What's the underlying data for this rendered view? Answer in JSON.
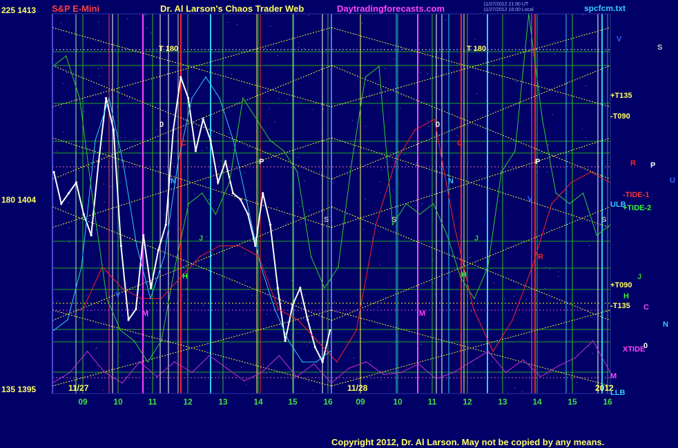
{
  "header": {
    "left_title": "S&P E-Mini",
    "center_title": "Dr. Al Larson's Chaos Trader Web",
    "site": "Daytradingforecasts.com",
    "file": "spcfcm.txt",
    "timestamp_1": "11/27/2012 21:00 UT",
    "timestamp_2": "11/27/2012 16:00 Local"
  },
  "y_axis": {
    "labels": [
      {
        "angle": "225",
        "price": "1413"
      },
      {
        "angle": "180",
        "price": "1404"
      },
      {
        "angle": "135",
        "price": "1395"
      }
    ]
  },
  "x_axis": {
    "day1_label": "11/27",
    "day2_label": "11/28",
    "year_label": "2012",
    "hours_day1": [
      "09",
      "10",
      "11",
      "12",
      "13",
      "14",
      "15",
      "16"
    ],
    "hours_day2": [
      "09",
      "10",
      "11",
      "12",
      "13",
      "14",
      "15",
      "16"
    ]
  },
  "line_labels": {
    "plus_t135": "+T135",
    "minus_t090": "-T090",
    "minus_tide_1": "-TIDE-1",
    "plus_tide_2": "+TIDE-2",
    "ulb": "ULB",
    "plus_t090": "+T090",
    "minus_t135": "-T135",
    "xtide": "XTIDE",
    "llb": "LLB"
  },
  "legend_letters": {
    "v": "V",
    "s": "S",
    "r": "R",
    "p": "P",
    "u": "U",
    "j": "J",
    "h": "H",
    "c": "C",
    "n": "N",
    "o": "0",
    "m": "M"
  },
  "chart_markers": {
    "t180_day1": "T 180",
    "t180_day2": "T 180",
    "o": "0",
    "p": "P",
    "s": "S",
    "h": "H",
    "v": "V",
    "m": "M",
    "n": "N",
    "c": "C",
    "j": "J",
    "r": "R"
  },
  "copyright": "Copyright 2012, Dr. Al Larson. May not be copied by any means.",
  "colors": {
    "background": "#000066",
    "grid_h": "#22aa22",
    "yellow": "#ffff00",
    "green": "#33cc33",
    "cyan": "#33ccff",
    "red": "#ff2222",
    "magenta": "#cc33cc",
    "white": "#ffffff",
    "violet": "#8888ff"
  },
  "chart_data": {
    "type": "line",
    "title": "S&P E-Mini",
    "ylim": [
      1395,
      1413
    ],
    "yticks": [
      1413,
      1404,
      1395
    ],
    "x_categories": [
      "11/27 09",
      "10",
      "11",
      "12",
      "13",
      "14",
      "15",
      "16",
      "11/28 09",
      "10",
      "11",
      "12",
      "13",
      "14",
      "15",
      "16"
    ],
    "series": [
      {
        "name": "price",
        "color": "#ffffff",
        "values": [
          1405.5,
          1404,
          1404.5,
          1405,
          1403.5,
          1402.5,
          1406,
          1409,
          1407.5,
          1402,
          1398.5,
          1399,
          1402.5,
          1400,
          1401.8,
          1403,
          1407.5,
          1410,
          1409,
          1406.5,
          1408,
          1407,
          1405,
          1406,
          1404.5,
          1404.2,
          1403.5,
          1402,
          1404.5,
          1403,
          1400,
          1397.5,
          1399.2,
          1400,
          1398.5,
          1397.2,
          1396.5,
          1398
        ]
      },
      {
        "name": "fcm",
        "color": "#33ccff",
        "values": [
          1398,
          1398.5,
          1401,
          1407,
          1409,
          1406,
          1402,
          1399.5,
          1401.5,
          1406,
          1409,
          1410,
          1409,
          1407,
          1404,
          1401,
          1399,
          1397.5,
          1396.5,
          1396.5,
          1397
        ]
      },
      {
        "name": "forecast",
        "color": "#33cc33",
        "values": [
          1410.5,
          1411,
          1409,
          1404,
          1399.5,
          1398,
          1397.5,
          1396.5,
          1397.5,
          1401,
          1404,
          1404.5,
          1403.5,
          1405,
          1409,
          1408,
          1407,
          1406.5,
          1405.5,
          1401.5,
          1400,
          1401,
          1406,
          1410,
          1410.5,
          1403,
          1404,
          1403.5,
          1404,
          1402.5,
          1400.5,
          1399.5,
          1401,
          1405.5,
          1406.5,
          1413,
          1408,
          1404.5,
          1404,
          1404.5,
          1402.5,
          1403
        ]
      },
      {
        "name": "red forecast",
        "color": "#ff2222",
        "values": [
          1399,
          1401,
          1400,
          1399.5,
          1399.5,
          1400.5,
          1401.5,
          1402,
          1402,
          1401.5,
          1399,
          1398.5,
          1397.5,
          1396.5,
          1398,
          1403,
          1406,
          1407.5,
          1408,
          1403,
          1399,
          1397,
          1398.5,
          1401,
          1404,
          1405,
          1405.5,
          1405
        ]
      },
      {
        "name": "xtide",
        "color": "#cc33cc",
        "values": [
          1395.5,
          1396,
          1397,
          1396,
          1395.5,
          1396.5,
          1395.8,
          1396.5,
          1396,
          1396.8,
          1396.2,
          1395.6,
          1396,
          1396.8,
          1395.8,
          1396.4,
          1395.5,
          1396.2,
          1396.5,
          1395.9,
          1396,
          1396.4,
          1395.7,
          1396,
          1396.5,
          1397,
          1396,
          1396.6,
          1395.8,
          1396.3,
          1396.7,
          1397.5,
          1396
        ]
      }
    ]
  }
}
